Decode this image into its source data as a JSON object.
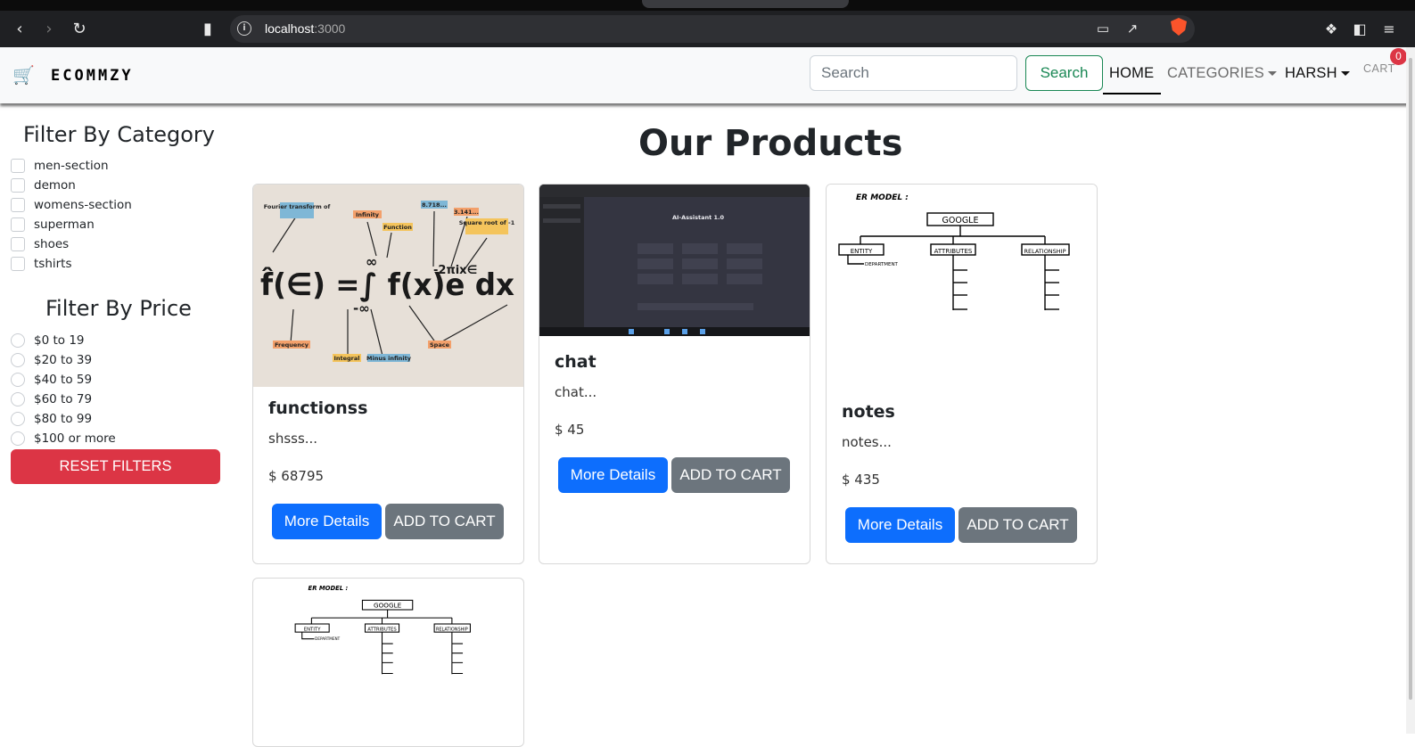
{
  "browser": {
    "url_host": "localhost",
    "url_port": ":3000"
  },
  "navbar": {
    "brand": "ECOMMZY",
    "search_placeholder": "Search",
    "search_button": "Search",
    "home": "HOME",
    "categories": "CATEGORIES",
    "user": "HARSH",
    "cart": "CART",
    "cart_count": "0"
  },
  "sidebar": {
    "category_title": "Filter By Category",
    "categories": [
      "men-section",
      "demon",
      "womens-section",
      "superman",
      "shoes",
      "tshirts"
    ],
    "price_title": "Filter By Price",
    "prices": [
      "$0 to 19",
      "$20 to 39",
      "$40 to 59",
      "$60 to 79",
      "$80 to 99",
      "$100 or more"
    ],
    "reset_button": "RESET FILTERS"
  },
  "main": {
    "heading": "Our Products",
    "more_details": "More Details",
    "add_to_cart": "ADD TO CART",
    "products": [
      {
        "name": "functionss",
        "description": "shsss...",
        "price": "$ 68795"
      },
      {
        "name": "chat",
        "description": "chat...",
        "price": "$ 45"
      },
      {
        "name": "notes",
        "description": "notes...",
        "price": "$ 435"
      }
    ]
  },
  "images": {
    "formula": {
      "labels": [
        "Fourier transform of",
        "Infinity",
        "Function",
        "8.718...",
        "3.141...",
        "Square root of -1",
        "Frequency",
        "Integral",
        "Minus infinity",
        "Space"
      ],
      "formula_text": "f̂(∈) =∫ f(x)e dx",
      "upper_limit": "∞",
      "lower_limit": "-∞",
      "exponent": "-2πix∈"
    },
    "chat_screenshot": {
      "title": "AI-Assistant 1.0"
    },
    "er": {
      "title": "ER MODEL :",
      "root": "GOOGLE",
      "entity": "ENTITY",
      "attributes": "ATTRIBUTES",
      "relationship": "RELATIONSHIP",
      "department": "DEPARTMENT"
    }
  }
}
